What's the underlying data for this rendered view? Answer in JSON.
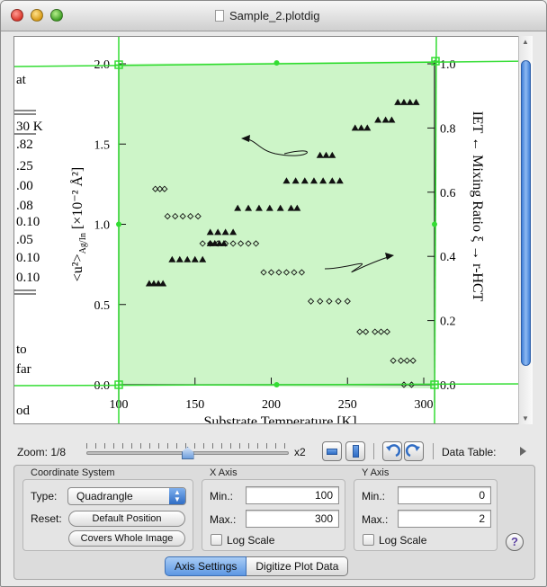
{
  "window": {
    "title": "Sample_2.plotdig"
  },
  "plot": {
    "y_label_main": "<u²>",
    "y_label_sub": "Ag/In",
    "y_label_unit": "[×10⁻² Å²]",
    "right_label": "IET ← Mixing Ratio ξ → r-HCT",
    "x_label": "Substrate Temperature [K]",
    "left_ticks": [
      "2.0",
      "1.5",
      "1.0",
      "0.5",
      "0.0"
    ],
    "right_ticks": [
      "1.0",
      "0.8",
      "0.6",
      "0.4",
      "0.2",
      "0.0"
    ],
    "bottom_ticks": [
      "100",
      "150",
      "200",
      "250",
      "300"
    ],
    "side_text": [
      "at",
      "30 K",
      ".82",
      ".25",
      ".00",
      ".08",
      "0.10",
      ".05",
      "0.10",
      "0.10",
      "to",
      "far",
      "od"
    ],
    "overlay_color": "#cdf5c8",
    "axis_color": "#33dd33"
  },
  "chart_data": {
    "type": "scatter",
    "title": "",
    "xlabel": "Substrate Temperature [K]",
    "ylabel": "<u²>Ag/In [×10⁻² Å²]",
    "y2label": "IET ← Mixing Ratio ξ → r-HCT",
    "xlim": [
      100,
      300
    ],
    "ylim": [
      0,
      2
    ],
    "y2lim": [
      0,
      1
    ],
    "series": [
      {
        "marker": "filled-triangle",
        "points": [
          [
            120,
            0.63
          ],
          [
            123,
            0.63
          ],
          [
            126,
            0.63
          ],
          [
            129,
            0.63
          ],
          [
            135,
            0.78
          ],
          [
            140,
            0.78
          ],
          [
            145,
            0.78
          ],
          [
            150,
            0.78
          ],
          [
            155,
            0.78
          ],
          [
            160,
            0.88
          ],
          [
            163,
            0.88
          ],
          [
            166,
            0.88
          ],
          [
            169,
            0.88
          ],
          [
            160,
            0.95
          ],
          [
            165,
            0.95
          ],
          [
            170,
            0.95
          ],
          [
            175,
            0.95
          ],
          [
            178,
            1.1
          ],
          [
            185,
            1.1
          ],
          [
            192,
            1.1
          ],
          [
            199,
            1.1
          ],
          [
            206,
            1.1
          ],
          [
            213,
            1.1
          ],
          [
            217,
            1.1
          ],
          [
            210,
            1.27
          ],
          [
            216,
            1.27
          ],
          [
            222,
            1.27
          ],
          [
            228,
            1.27
          ],
          [
            234,
            1.27
          ],
          [
            240,
            1.27
          ],
          [
            245,
            1.27
          ],
          [
            232,
            1.43
          ],
          [
            236,
            1.43
          ],
          [
            240,
            1.43
          ],
          [
            255,
            1.6
          ],
          [
            259,
            1.6
          ],
          [
            263,
            1.6
          ],
          [
            270,
            1.65
          ],
          [
            275,
            1.65
          ],
          [
            279,
            1.65
          ],
          [
            283,
            1.76
          ],
          [
            287,
            1.76
          ],
          [
            291,
            1.76
          ],
          [
            295,
            1.76
          ]
        ]
      },
      {
        "marker": "open-diamond",
        "points": [
          [
            124,
            1.22
          ],
          [
            127,
            1.22
          ],
          [
            130,
            1.22
          ],
          [
            132,
            1.05
          ],
          [
            137,
            1.05
          ],
          [
            142,
            1.05
          ],
          [
            147,
            1.05
          ],
          [
            152,
            1.05
          ],
          [
            155,
            0.88
          ],
          [
            160,
            0.88
          ],
          [
            165,
            0.88
          ],
          [
            170,
            0.88
          ],
          [
            175,
            0.88
          ],
          [
            180,
            0.88
          ],
          [
            185,
            0.88
          ],
          [
            190,
            0.88
          ],
          [
            195,
            0.7
          ],
          [
            200,
            0.7
          ],
          [
            205,
            0.7
          ],
          [
            210,
            0.7
          ],
          [
            215,
            0.7
          ],
          [
            220,
            0.7
          ],
          [
            226,
            0.52
          ],
          [
            232,
            0.52
          ],
          [
            238,
            0.52
          ],
          [
            244,
            0.52
          ],
          [
            250,
            0.52
          ],
          [
            258,
            0.33
          ],
          [
            262,
            0.33
          ],
          [
            268,
            0.33
          ],
          [
            272,
            0.33
          ],
          [
            276,
            0.33
          ],
          [
            280,
            0.15
          ],
          [
            285,
            0.15
          ],
          [
            289,
            0.15
          ],
          [
            293,
            0.15
          ],
          [
            287,
            0.0
          ],
          [
            292,
            0.0
          ]
        ]
      }
    ]
  },
  "zoom": {
    "label": "Zoom: 1/8",
    "max_label": "x2",
    "level": 0.5,
    "data_table_label": "Data Table:"
  },
  "coordinate_system": {
    "title": "Coordinate System",
    "type_label": "Type:",
    "type_value": "Quadrangle",
    "reset_label": "Reset:",
    "default_position_button": "Default Position",
    "covers_whole_image_button": "Covers Whole Image"
  },
  "x_axis": {
    "title": "X Axis",
    "min_label": "Min.:",
    "min_value": "100",
    "max_label": "Max.:",
    "max_value": "300",
    "log_scale_label": "Log Scale",
    "log_scale_checked": false
  },
  "y_axis": {
    "title": "Y Axis",
    "min_label": "Min.:",
    "min_value": "0",
    "max_label": "Max.:",
    "max_value": "2",
    "log_scale_label": "Log Scale",
    "log_scale_checked": false
  },
  "help_label": "?",
  "tabs": [
    {
      "label": "Axis Settings",
      "active": true
    },
    {
      "label": "Digitize Plot Data",
      "active": false
    }
  ]
}
